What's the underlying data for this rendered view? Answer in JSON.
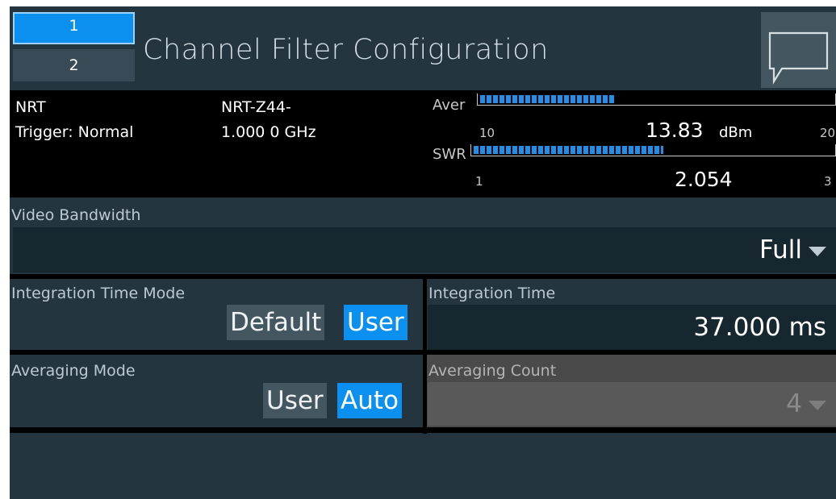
{
  "header": {
    "tabs": [
      {
        "label": "1"
      },
      {
        "label": "2"
      }
    ],
    "title": "Channel Filter Configuration"
  },
  "status": {
    "sensor": "NRT",
    "trigger": "Trigger: Normal",
    "model": "NRT-Z44-",
    "frequency": "1.000 0 GHz",
    "meters": [
      {
        "label": "Aver",
        "scale_min": "10",
        "scale_max": "20",
        "value": "13.83",
        "unit": "dBm",
        "fill": 0.383
      },
      {
        "label": "SWR",
        "scale_min": "1",
        "scale_max": "3",
        "value": "2.054",
        "unit": "",
        "fill": 0.527
      }
    ]
  },
  "video_bandwidth": {
    "label": "Video Bandwidth",
    "value": "Full"
  },
  "integration_time_mode": {
    "label": "Integration Time Mode",
    "options": [
      "Default",
      "User"
    ],
    "selected": "User"
  },
  "integration_time": {
    "label": "Integration Time",
    "value": "37.000 ms"
  },
  "averaging_mode": {
    "label": "Averaging Mode",
    "options": [
      "User",
      "Auto"
    ],
    "selected": "Auto"
  },
  "averaging_count": {
    "label": "Averaging Count",
    "value": "4",
    "enabled": false
  },
  "colors": {
    "accent": "#0c90f0",
    "panel": "#243540",
    "field": "#172730",
    "toggle_off": "#445761",
    "disabled": "#4a4a4a"
  },
  "icons": {
    "message": "message-bubble-icon",
    "dropdown": "dropdown-triangle-icon"
  }
}
